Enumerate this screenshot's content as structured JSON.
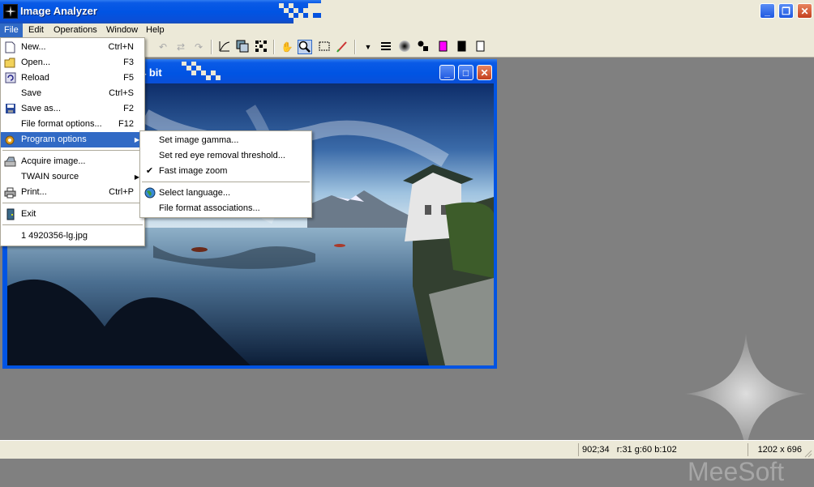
{
  "app": {
    "title": "Image Analyzer"
  },
  "menubar": {
    "items": [
      "File",
      "Edit",
      "Operations",
      "Window",
      "Help"
    ]
  },
  "file_menu": {
    "items": [
      {
        "label": "New...",
        "shortcut": "Ctrl+N",
        "icon": "new-file-icon"
      },
      {
        "label": "Open...",
        "shortcut": "F3",
        "icon": "open-folder-icon"
      },
      {
        "label": "Reload",
        "shortcut": "F5",
        "icon": "reload-icon"
      },
      {
        "label": "Save",
        "shortcut": "Ctrl+S",
        "icon": ""
      },
      {
        "label": "Save as...",
        "shortcut": "F2",
        "icon": "floppy-disk-icon"
      },
      {
        "label": "File format options...",
        "shortcut": "F12",
        "icon": ""
      },
      {
        "label": "Program options",
        "shortcut": "",
        "icon": "program-options-icon"
      },
      {
        "label": "Acquire image...",
        "shortcut": "",
        "icon": "scanner-icon"
      },
      {
        "label": "TWAIN source",
        "shortcut": "",
        "icon": ""
      },
      {
        "label": "Print...",
        "shortcut": "Ctrl+P",
        "icon": "printer-icon"
      },
      {
        "label": "Exit",
        "shortcut": "",
        "icon": "exit-door-icon"
      },
      {
        "label": "1 4920356-lg.jpg",
        "shortcut": "",
        "icon": ""
      }
    ]
  },
  "program_options_menu": {
    "items": [
      {
        "label": "Set image gamma..."
      },
      {
        "label": "Set red eye removal threshold..."
      },
      {
        "label": "Fast image zoom",
        "checked": true
      },
      {
        "label": "Select language...",
        "icon": "globe-icon"
      },
      {
        "label": "File format associations..."
      }
    ]
  },
  "child_window": {
    "title_fragment": "4 bit"
  },
  "statusbar": {
    "coords": "902;34",
    "pixel": "r:31 g:60 b:102",
    "size": "1202 x 696"
  },
  "logo": {
    "text": "MeeSoft"
  },
  "colors": {
    "accent": "#316ac5",
    "titlebar": "#0054e3",
    "workspace": "#808080",
    "menu_bg": "#ece9d8"
  }
}
